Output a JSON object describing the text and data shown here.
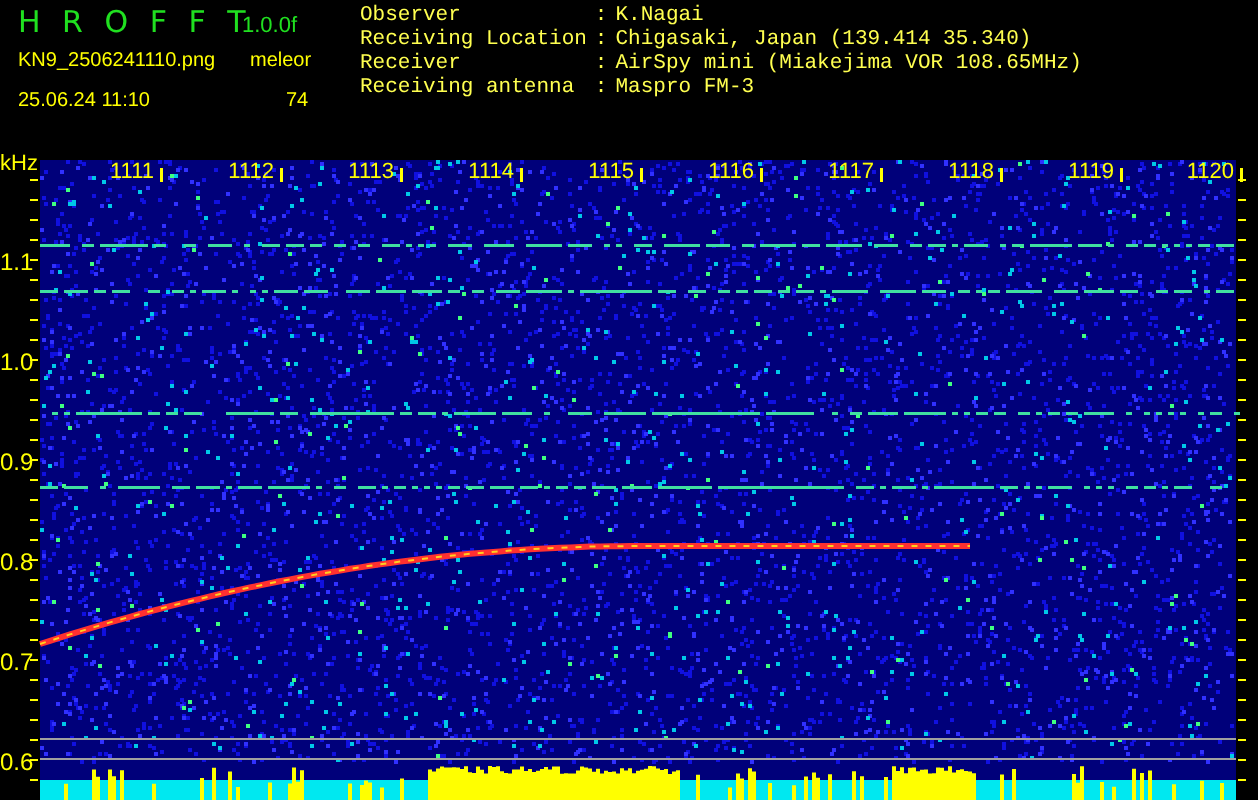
{
  "header": {
    "app_title": "H R O F F T",
    "version": "1.0.0f",
    "filename": "KN9_2506241110.png",
    "detection_label": "meleor",
    "detection_count": "74",
    "timestamp": "25.06.24 11:10"
  },
  "info": [
    {
      "label": "Observer",
      "separator": ":",
      "value": "K.Nagai"
    },
    {
      "label": "Receiving Location",
      "separator": ":",
      "value": "Chigasaki, Japan (139.414 35.340)"
    },
    {
      "label": "Receiver",
      "separator": ":",
      "value": "AirSpy mini (Miakejima VOR 108.65MHz)"
    },
    {
      "label": "Receiving antenna",
      "separator": ":",
      "value": "Maspro FM-3"
    }
  ],
  "plot": {
    "unit": "kHz",
    "x_ticks": [
      "1111",
      "1112",
      "1113",
      "1114",
      "1115",
      "1116",
      "1117",
      "1118",
      "1119",
      "1120"
    ],
    "y_ticks": [
      "1.1",
      "1.0",
      "0.9",
      "0.8",
      "0.7",
      "0.6"
    ]
  }
}
